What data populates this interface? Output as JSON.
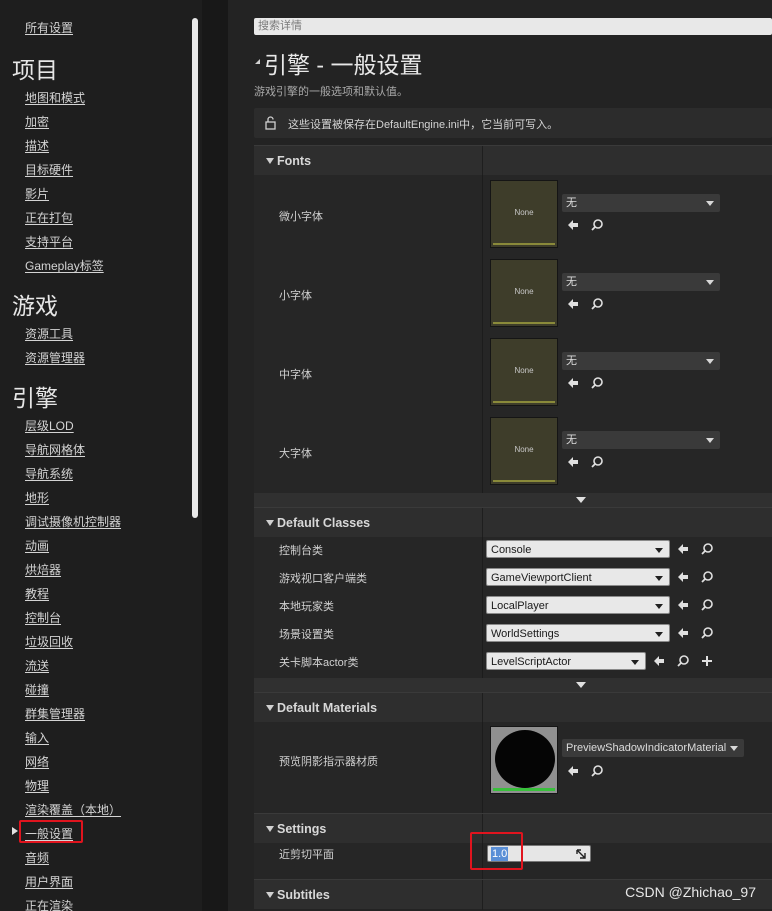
{
  "sidebar": {
    "all_settings": "所有设置",
    "sections": [
      {
        "title": "项目",
        "items": [
          "地图和模式",
          "加密",
          "描述",
          "目标硬件",
          "影片",
          "正在打包",
          "支持平台",
          "Gameplay标签"
        ]
      },
      {
        "title": "游戏",
        "items": [
          "资源工具",
          "资源管理器"
        ]
      },
      {
        "title": "引擎",
        "items": [
          "层级LOD",
          "导航网格体",
          "导航系统",
          "地形",
          "调试摄像机控制器",
          "动画",
          "烘焙器",
          "教程",
          "控制台",
          "垃圾回收",
          "流送",
          "碰撞",
          "群集管理器",
          "输入",
          "网络",
          "物理",
          "渲染覆盖（本地）",
          "一般设置",
          "音频",
          "用户界面",
          "正在渲染"
        ]
      }
    ],
    "active_item": "一般设置"
  },
  "main": {
    "search_placeholder": "搜索详情",
    "title": "引擎 - 一般设置",
    "subtitle": "游戏引擎的一般选项和默认值。",
    "notice": "这些设置被保存在DefaultEngine.ini中，它当前可写入。",
    "categories": {
      "fonts": "Fonts",
      "default_classes": "Default Classes",
      "default_materials": "Default Materials",
      "settings": "Settings",
      "subtitles": "Subtitles"
    },
    "fonts": [
      {
        "label": "微小字体",
        "thumb": "None",
        "value": "无"
      },
      {
        "label": "小字体",
        "thumb": "None",
        "value": "无"
      },
      {
        "label": "中字体",
        "thumb": "None",
        "value": "无"
      },
      {
        "label": "大字体",
        "thumb": "None",
        "value": "无"
      }
    ],
    "classes": [
      {
        "label": "控制台类",
        "value": "Console"
      },
      {
        "label": "游戏视口客户端类",
        "value": "GameViewportClient"
      },
      {
        "label": "本地玩家类",
        "value": "LocalPlayer"
      },
      {
        "label": "场景设置类",
        "value": "WorldSettings"
      },
      {
        "label": "关卡脚本actor类",
        "value": "LevelScriptActor"
      }
    ],
    "materials": [
      {
        "label": "预览阴影指示器材质",
        "value": "PreviewShadowIndicatorMaterial"
      }
    ],
    "settings": [
      {
        "label": "近剪切平面",
        "value": "1.0"
      }
    ]
  },
  "watermark": "CSDN @Zhichao_97",
  "colors": {
    "highlight_box": "#e0141e",
    "selection": "#5a8fd6"
  }
}
